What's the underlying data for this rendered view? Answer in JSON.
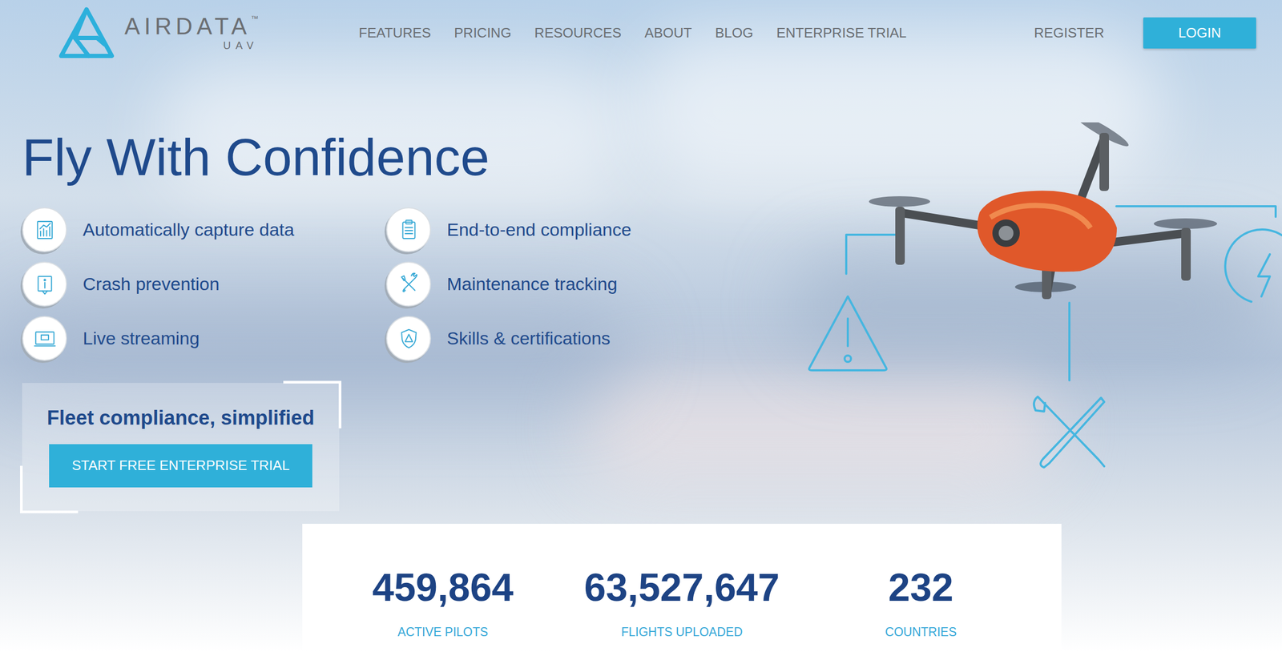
{
  "logo": {
    "name": "AIRDATA",
    "trademark": "™",
    "sub": "UAV"
  },
  "nav": [
    "FEATURES",
    "PRICING",
    "RESOURCES",
    "ABOUT",
    "BLOG",
    "ENTERPRISE TRIAL"
  ],
  "auth": {
    "register": "REGISTER",
    "login": "LOGIN"
  },
  "hero": {
    "title": "Fly With Confidence",
    "features": [
      {
        "label": "Automatically capture data",
        "kind": "chart"
      },
      {
        "label": "End-to-end compliance",
        "kind": "clipboard"
      },
      {
        "label": "Crash prevention",
        "kind": "info"
      },
      {
        "label": "Maintenance tracking",
        "kind": "tools"
      },
      {
        "label": "Live streaming",
        "kind": "live"
      },
      {
        "label": "Skills & certifications",
        "kind": "shield"
      }
    ],
    "cta": {
      "title": "Fleet compliance, simplified",
      "button": "START FREE ENTERPRISE TRIAL"
    }
  },
  "stats": [
    {
      "value": "459,864",
      "label": "ACTIVE PILOTS"
    },
    {
      "value": "63,527,647",
      "label": "FLIGHTS UPLOADED"
    },
    {
      "value": "232",
      "label": "COUNTRIES"
    }
  ]
}
